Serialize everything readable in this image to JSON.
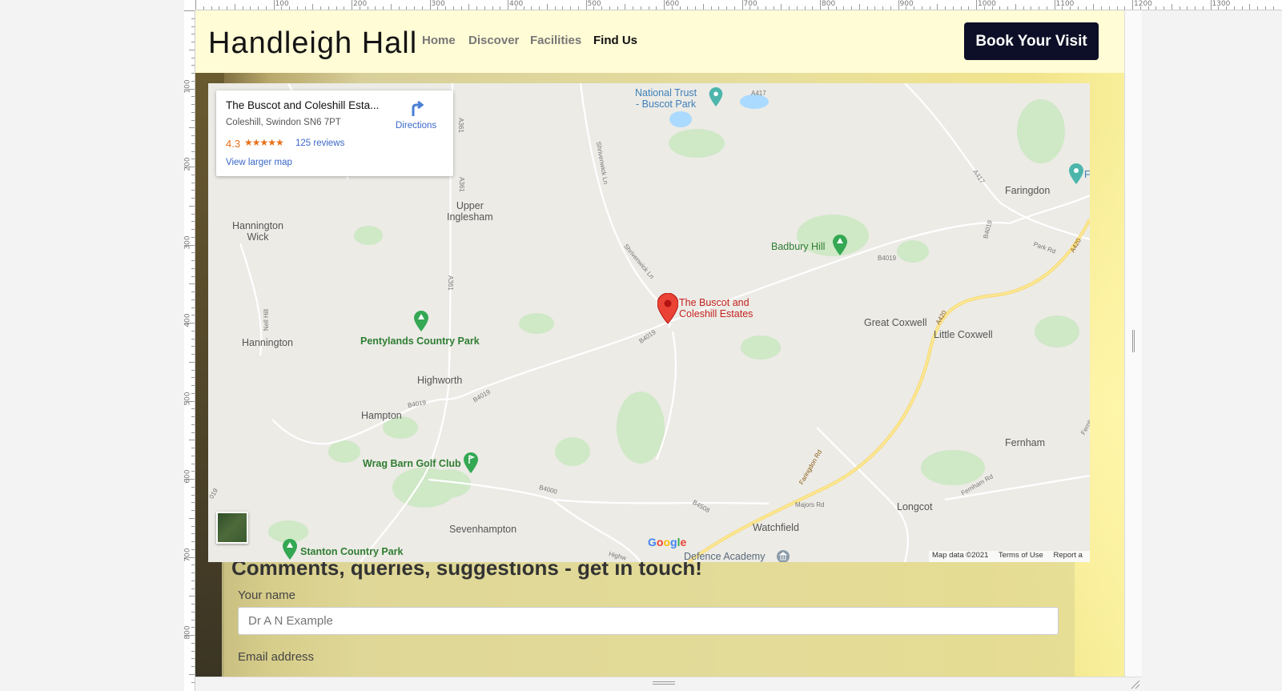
{
  "site": {
    "title": "Handleigh Hall",
    "nav": [
      "Home",
      "Discover",
      "Facilities",
      "Find Us"
    ],
    "active_nav": "Find Us",
    "cta": "Book Your Visit"
  },
  "map": {
    "card": {
      "title": "The Buscot and Coleshill Esta...",
      "address": "Coleshill, Swindon SN6 7PT",
      "rating": "4.3",
      "stars": "★★★★★",
      "reviews": "125 reviews",
      "larger_link": "View larger map",
      "directions": "Directions"
    },
    "marker_label": [
      "The Buscot and",
      "Coleshill Estates"
    ],
    "places": {
      "upper_inglesham": [
        "Upper",
        "Inglesham"
      ],
      "hannington_wick": [
        "Hannington",
        "Wick"
      ],
      "hannington": "Hannington",
      "highworth": "Highworth",
      "hampton": "Hampton",
      "sevenhampton": "Sevenhampton",
      "watchfield": "Watchfield",
      "longcot": "Longcot",
      "fernham": "Fernham",
      "great_coxwell": "Great Coxwell",
      "little_coxwell": "Little Coxwell",
      "faringdon": "Faringdon"
    },
    "parks": {
      "pentylands": "Pentylands Country Park",
      "wrag_barn": "Wrag Barn Golf Club",
      "stanton": "Stanton Country Park",
      "badbury": "Badbury Hill"
    },
    "pois": {
      "national_trust": [
        "National Trust",
        "- Buscot Park"
      ],
      "defence_academy": "Defence Academy",
      "edge_f": "F"
    },
    "roads": {
      "a417_top": "A417",
      "a417_right": "A417",
      "a361_a": "A361",
      "a361_b": "A361",
      "a361_c": "A361",
      "shrivenham_a": "Shrivenwick Ln",
      "shrivenham_b": "Shrivenwick Ln",
      "b4019_a": "B4019",
      "b4019_b": "B4019",
      "b4019_c": "B4019",
      "b4019_d": "B4019",
      "b4019_e": "B4019",
      "b4000": "B4000",
      "b4508": "B4508",
      "a420_a": "A420",
      "a420_b": "A420",
      "faringdon_rd": "Faringdon Rd",
      "majors_rd": "Majors Rd",
      "fernham_rd": "Fernham Rd",
      "fernham_rd_edge": "Fernham",
      "park_rd": "Park Rd",
      "nell_hill": "Nell Hill",
      "edge_019": "019",
      "highw": "Highw"
    },
    "logo": "Google",
    "attribution": [
      "Map data ©2021",
      "Terms of Use",
      "Report a"
    ]
  },
  "form": {
    "heading": "Comments, queries, suggestions - get in touch!",
    "name_label": "Your name",
    "name_placeholder": "Dr A N Example",
    "email_label": "Email address"
  },
  "ruler": {
    "top_labels": [
      "100",
      "200",
      "300",
      "400",
      "500",
      "600",
      "700",
      "800",
      "900",
      "1000",
      "1100",
      "1200",
      "1300"
    ],
    "left_labels": [
      "100",
      "200",
      "300",
      "400",
      "500",
      "600",
      "700",
      "800"
    ]
  },
  "colors": {
    "header_bg": "#fffcd6",
    "cta_bg": "#0c0f27",
    "park_green": "#2f7d32",
    "marker_red": "#c5221f",
    "link_blue": "#3a67c8"
  }
}
